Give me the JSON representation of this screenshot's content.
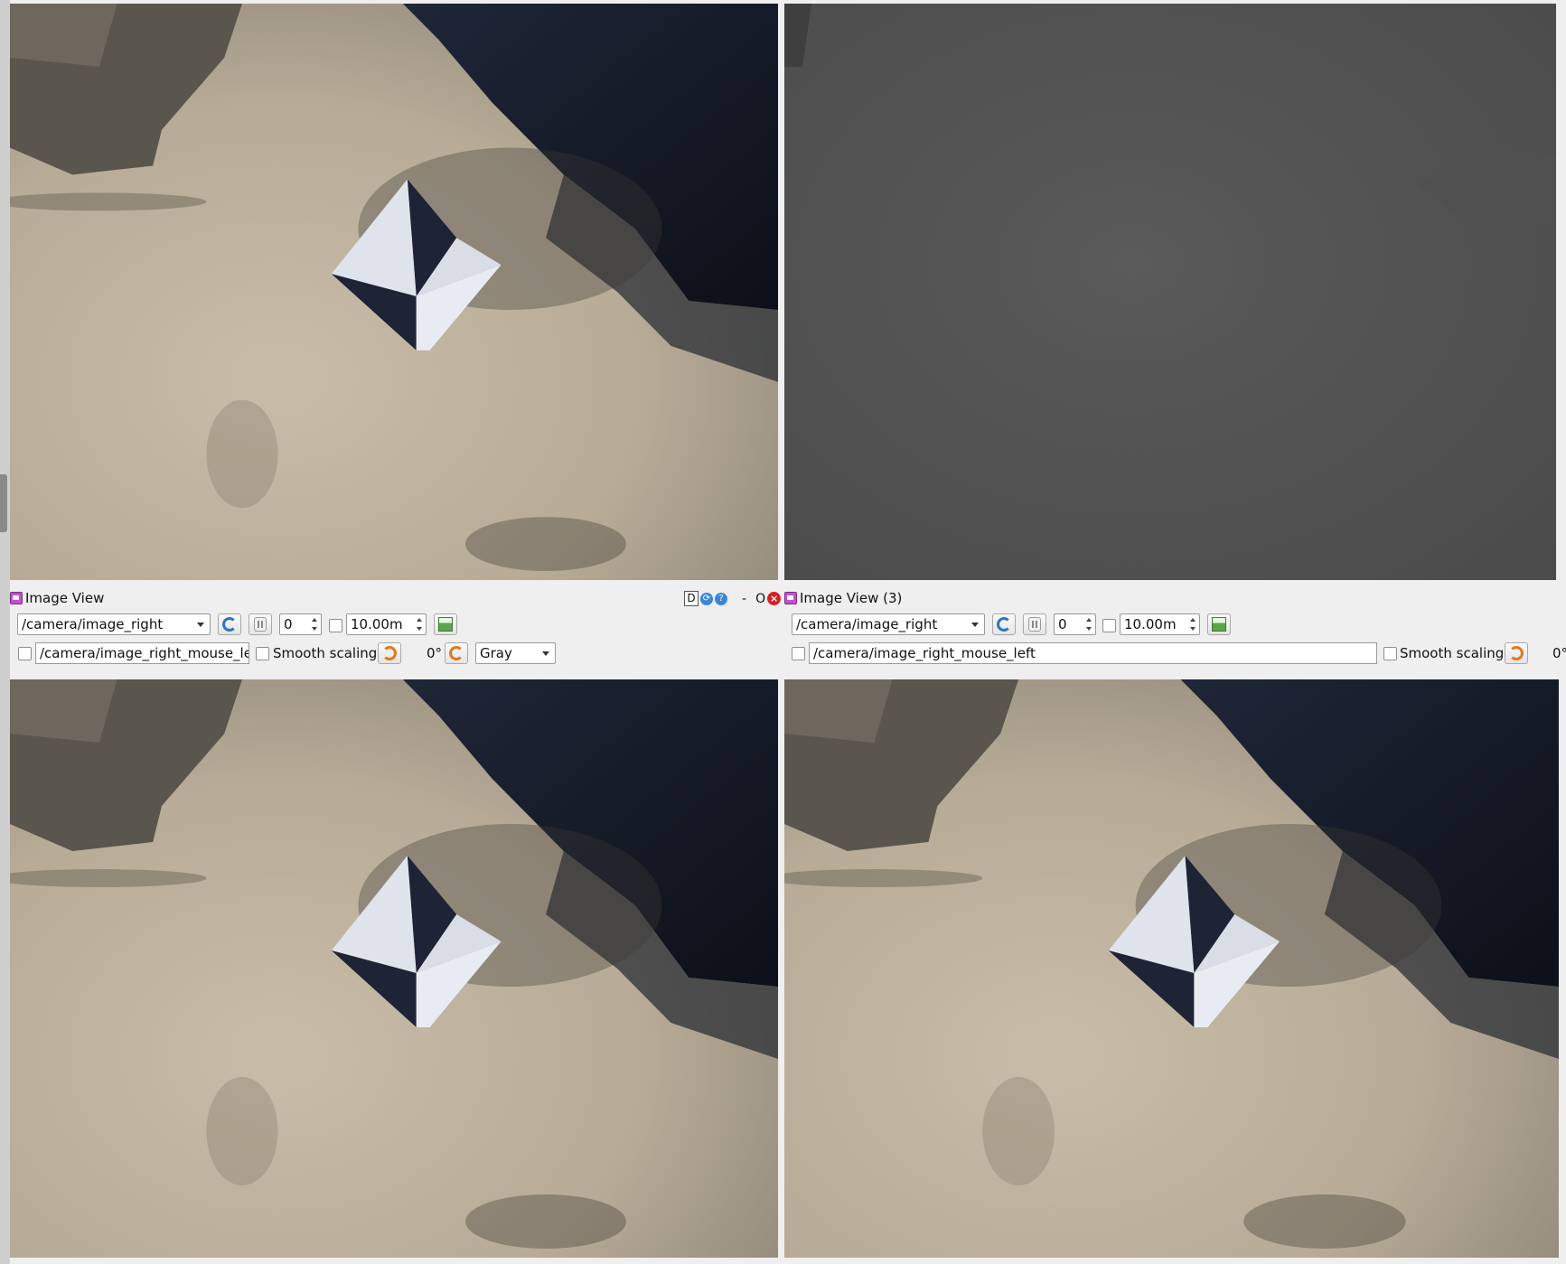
{
  "panels": [
    {
      "title": "Image View",
      "topic": "/camera/image_right",
      "spin_value": "0",
      "max_range": "10.00m",
      "mouse_topic": "/camera/image_right_mouse_left",
      "smooth_label": "Smooth scaling",
      "rotation": "0°",
      "colormap": "Gray"
    },
    {
      "title": "Image View (3)",
      "topic": "/camera/image_right",
      "spin_value": "0",
      "max_range": "10.00m",
      "mouse_topic": "/camera/image_right_mouse_left",
      "smooth_label": "Smooth scaling",
      "rotation": "0°"
    }
  ],
  "window_controls": {
    "d_label": "D",
    "dash": "-",
    "o_label": "O",
    "help": "?"
  },
  "icons": [
    "refresh-icon",
    "pause-icon",
    "save-image-icon",
    "rotate-right-icon",
    "rotate-left-icon",
    "close-icon",
    "help-icon",
    "image-view-icon"
  ]
}
